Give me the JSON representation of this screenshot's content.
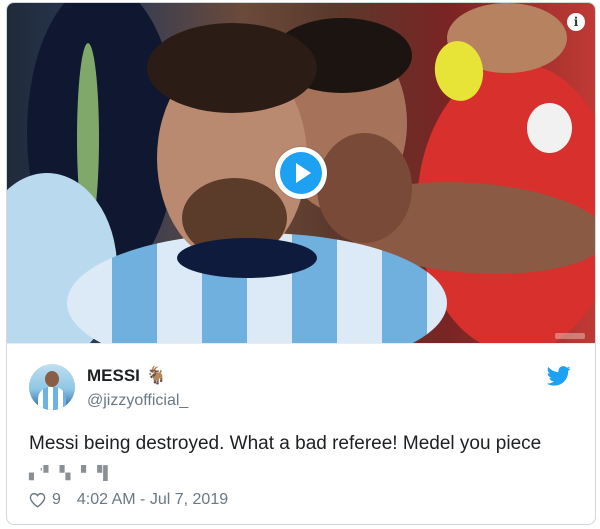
{
  "video": {
    "info_icon": "info-icon",
    "play_icon": "play-icon",
    "info_glyph": "i"
  },
  "tweet": {
    "display_name": "MESSI",
    "name_emoji": "🐐",
    "handle": "@jizzyofficial_",
    "text": "Messi being destroyed. What a bad referee! Medel you piece",
    "text_tail": "▖'▘▝▖ ▘▝▌",
    "like_count": "9",
    "timestamp": "4:02 AM - Jul 7, 2019"
  },
  "colors": {
    "twitter_blue": "#1da1f2",
    "text_primary": "#1c2022",
    "text_secondary": "#697882"
  }
}
